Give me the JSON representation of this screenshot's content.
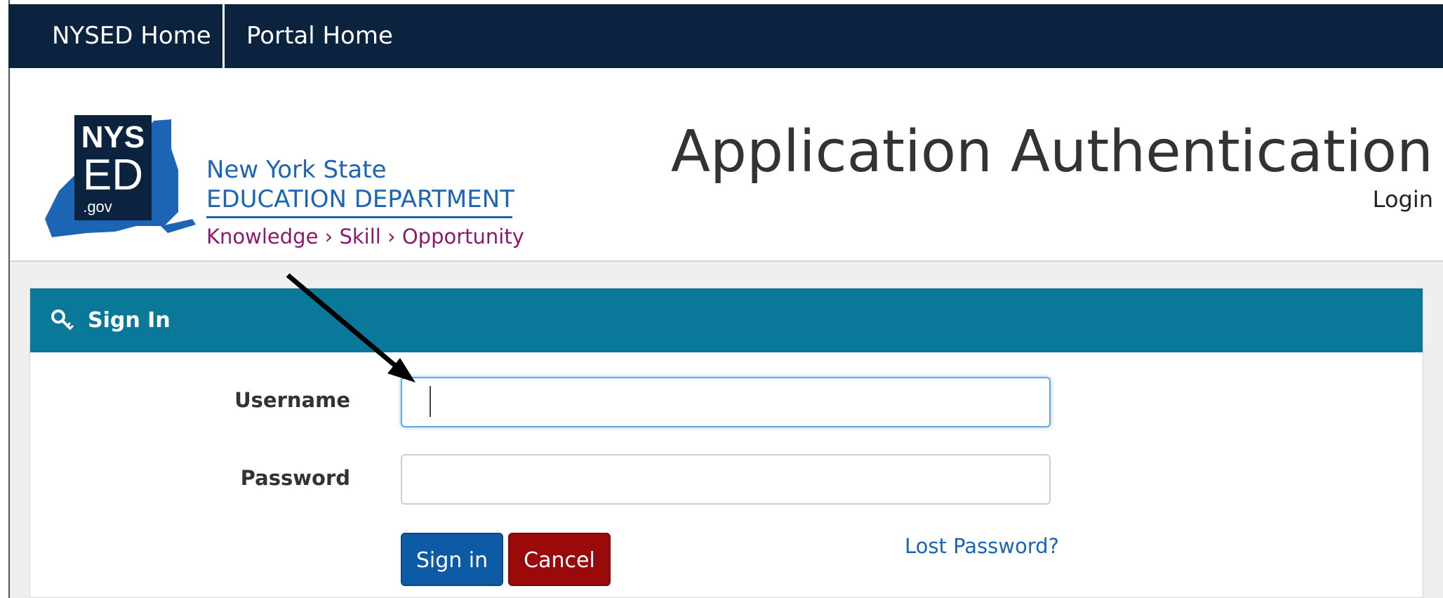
{
  "nav": {
    "items": [
      {
        "label": "NYSED Home"
      },
      {
        "label": "Portal Home"
      }
    ]
  },
  "header": {
    "logo": {
      "badge_top": "NYS",
      "badge_mid": "ED",
      "badge_bottom": ".gov",
      "line1": "New York State",
      "line2": "EDUCATION DEPARTMENT",
      "line3": "Knowledge › Skill › Opportunity"
    },
    "title": "Application Authentication",
    "subtitle": "Login"
  },
  "signin": {
    "heading": "Sign In",
    "username_label": "Username",
    "username_value": "",
    "password_label": "Password",
    "password_value": "",
    "signin_button": "Sign in",
    "cancel_button": "Cancel",
    "lost_password": "Lost Password?"
  },
  "colors": {
    "nav_bg": "#0c2340",
    "panel_header": "#0a7898",
    "signin_button": "#0d5aa7",
    "cancel_button": "#9b0a0a",
    "link": "#1c64b4",
    "logo_blue": "#1c64b4",
    "logo_magenta": "#8b1a6e"
  },
  "icons": {
    "panel_heading_icon": "key-icon",
    "annotation": "arrow-icon"
  }
}
